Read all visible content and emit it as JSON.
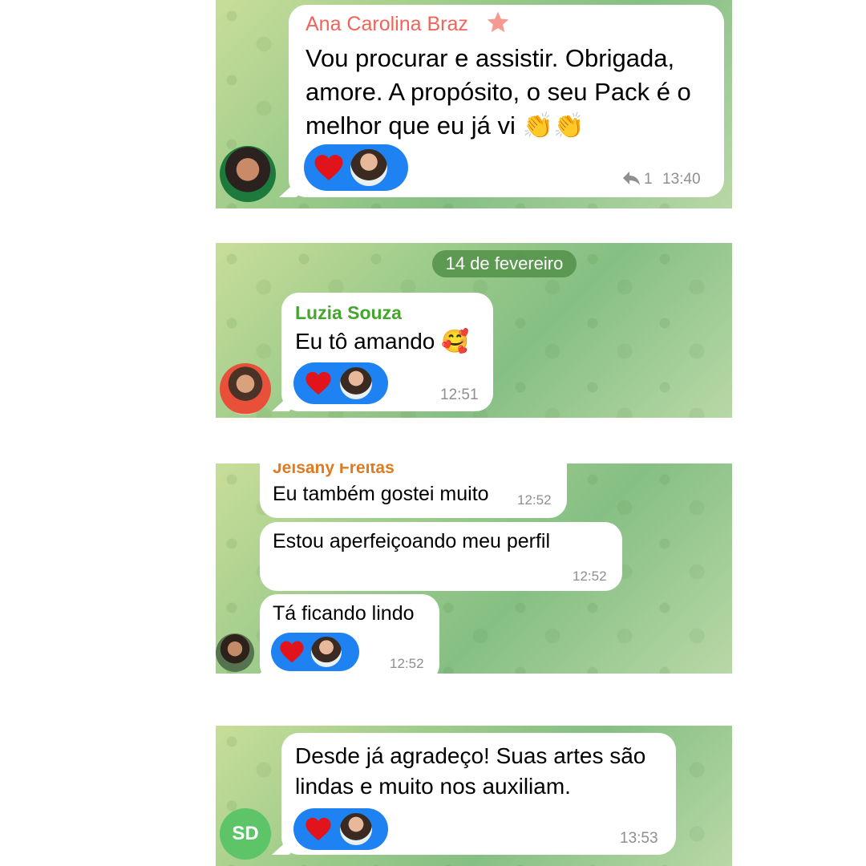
{
  "messages": [
    {
      "sender": "Ana Carolina Braz",
      "sender_color": "#f0645a",
      "text_lines": [
        "Vou procurar e assistir. Obrigada,",
        "amore. A propósito, o seu Pack é o",
        "melhor que eu já vi 👏👏"
      ],
      "reply_count": "1",
      "time": "13:40"
    },
    {
      "date_separator": "14 de fevereiro",
      "sender": "Luzia Souza",
      "sender_color": "#45a52e",
      "text": "Eu tô amando 🥰",
      "time": "12:51"
    },
    {
      "sender": "Jeisany Freitas",
      "sender_color": "#e07a1f",
      "items": [
        {
          "text": "Eu também gostei muito",
          "time": "12:52"
        },
        {
          "text": "Estou aperfeiçoando meu perfil",
          "time": "12:52"
        },
        {
          "text": "Tá ficando lindo",
          "time": "12:52"
        }
      ]
    },
    {
      "avatar_initials": "SD",
      "avatar_color": "#5dc468",
      "text_lines": [
        "Desde já agradeço! Suas artes são",
        "lindas e muito nos auxiliam."
      ],
      "time": "13:53"
    }
  ],
  "reaction_icon": "red-heart",
  "accent": "#1e82f2"
}
